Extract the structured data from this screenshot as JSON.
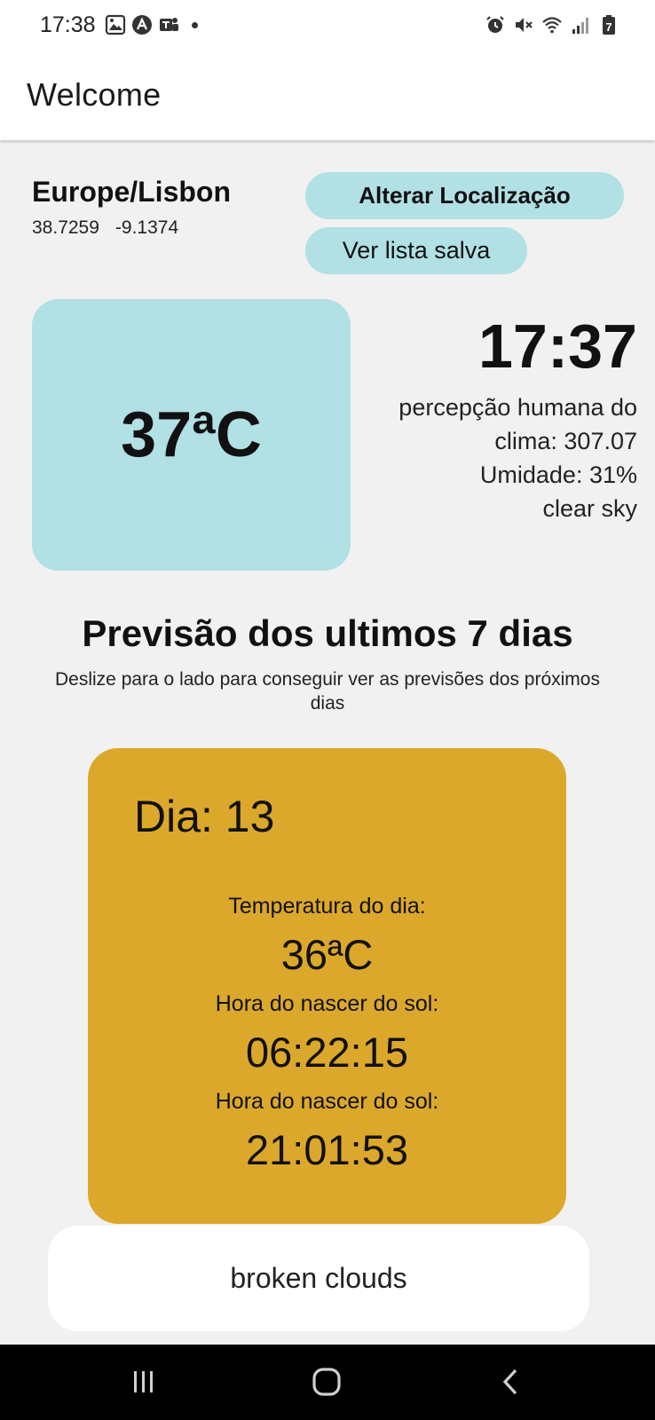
{
  "status_bar": {
    "time": "17:38",
    "icons_left": [
      "gallery-notification-icon",
      "app-a-icon",
      "teams-icon",
      "dot-icon"
    ],
    "icons_right": [
      "alarm-icon",
      "mute-icon",
      "wifi-icon",
      "signal-icon",
      "battery-icon"
    ],
    "battery": "7"
  },
  "appbar": {
    "title": "Welcome"
  },
  "location": {
    "name": "Europe/Lisbon",
    "lat": "38.7259",
    "lon": "-9.1374"
  },
  "buttons": {
    "change_location": "Alterar Localização",
    "saved_list": "Ver lista salva"
  },
  "current": {
    "temperature": "37ªC",
    "time": "17:37",
    "feels_like": "percepção humana do clima: 307.07",
    "humidity": "Umidade: 31%",
    "description": "clear sky"
  },
  "forecast": {
    "title": "Previsão dos ultimos 7 dias",
    "subtitle": "Deslize para o lado para conseguir ver as previsões dos próximos dias",
    "card": {
      "day": "Dia: 13",
      "temp_label": "Temperatura do dia:",
      "temp_value": "36ªC",
      "sunrise_label": "Hora do nascer do sol:",
      "sunrise_value": "06:22:15",
      "sunset_label": "Hora do nascer do sol:",
      "sunset_value": "21:01:53",
      "description": "broken clouds"
    }
  },
  "colors": {
    "accent_light_blue": "#b1e0e5",
    "card_gold": "#dca82c",
    "background": "#f1f1f1"
  },
  "nav": {
    "icons": [
      "recent-apps-icon",
      "home-icon",
      "back-icon"
    ]
  }
}
